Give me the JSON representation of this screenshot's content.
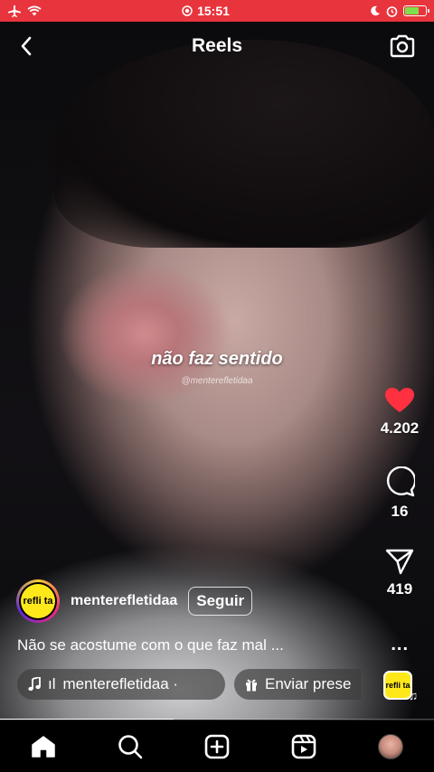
{
  "status_bar": {
    "time": "15:51",
    "icons_left": [
      "airplane-icon",
      "wifi-icon"
    ],
    "icons_right": [
      "moon-icon",
      "alarm-icon",
      "battery-icon"
    ],
    "battery_level": 0.7,
    "background": "#e8343c"
  },
  "header": {
    "title": "Reels"
  },
  "video": {
    "overlay_text": "não faz sentido",
    "overlay_handle": "@menterefletidaa"
  },
  "actions": {
    "likes": "4.202",
    "comments": "16",
    "shares": "419",
    "more": "...",
    "like_color": "#ff3040"
  },
  "author": {
    "avatar_text": "refli ta",
    "username": "menterefletidaa",
    "follow_label": "Seguir"
  },
  "caption": "Não se acostume com o que faz mal ...",
  "chips": {
    "audio_prefix": "ıl",
    "audio_label": "menterefletidaa ·",
    "gift_label": "Enviar prese"
  },
  "audio_thumb_text": "refli ta",
  "progress": 0.4,
  "nav": [
    "home-icon",
    "search-icon",
    "create-icon",
    "reels-icon",
    "profile-avatar"
  ]
}
